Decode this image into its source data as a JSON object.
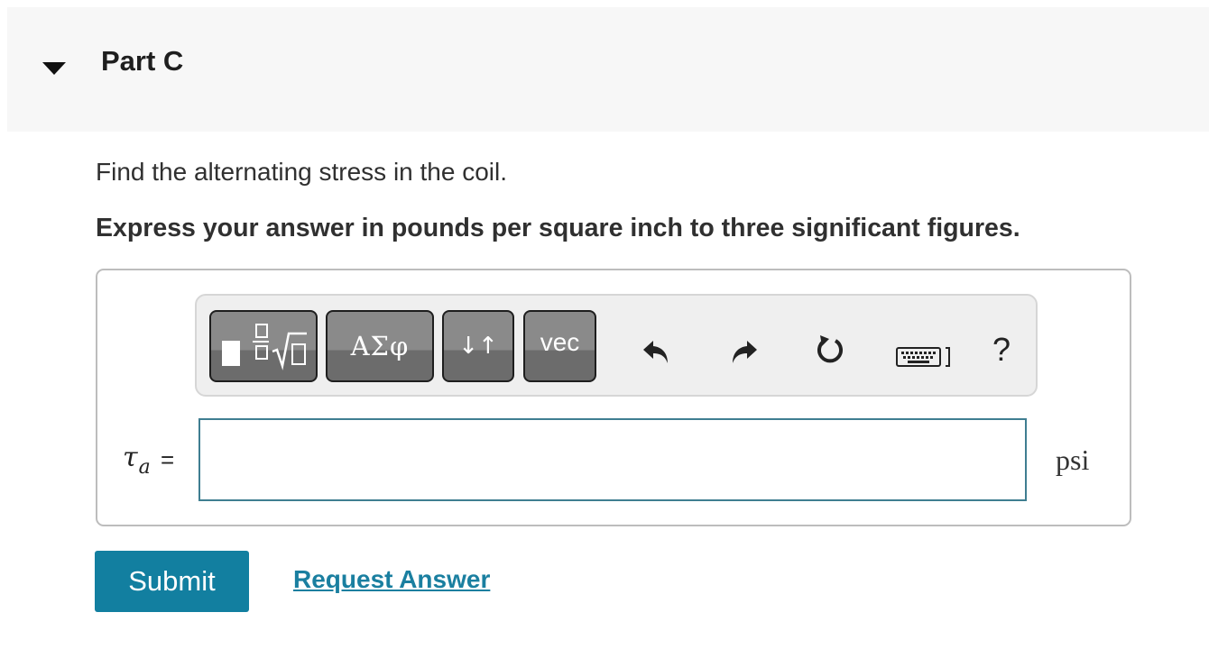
{
  "part": {
    "title": "Part C",
    "toggle_icon": "caret-down-icon",
    "expanded": true
  },
  "question": {
    "prompt": "Find the alternating stress in the coil.",
    "instruction": "Express your answer in pounds per square inch to three significant figures."
  },
  "toolbar": {
    "buttons": [
      {
        "name": "templates",
        "icon": "fraction-radical-template-icon"
      },
      {
        "name": "greek",
        "label": "ΑΣφ"
      },
      {
        "name": "arrows",
        "label": "↓↑"
      },
      {
        "name": "vector",
        "label": "vec"
      }
    ],
    "icons": [
      "undo-icon",
      "redo-icon",
      "reset-icon",
      "keyboard-icon",
      "help-icon"
    ],
    "help_label": "?"
  },
  "answer": {
    "variable": "τ",
    "subscript": "a",
    "equals": "=",
    "value": "",
    "unit": "psi"
  },
  "actions": {
    "submit_label": "Submit",
    "request_label": "Request Answer"
  },
  "colors": {
    "header_bg": "#f7f7f7",
    "submit_bg": "#127fa0",
    "link": "#1a7fa0",
    "input_border": "#3f7e91",
    "toolbar_button": "#7a7a7a"
  }
}
